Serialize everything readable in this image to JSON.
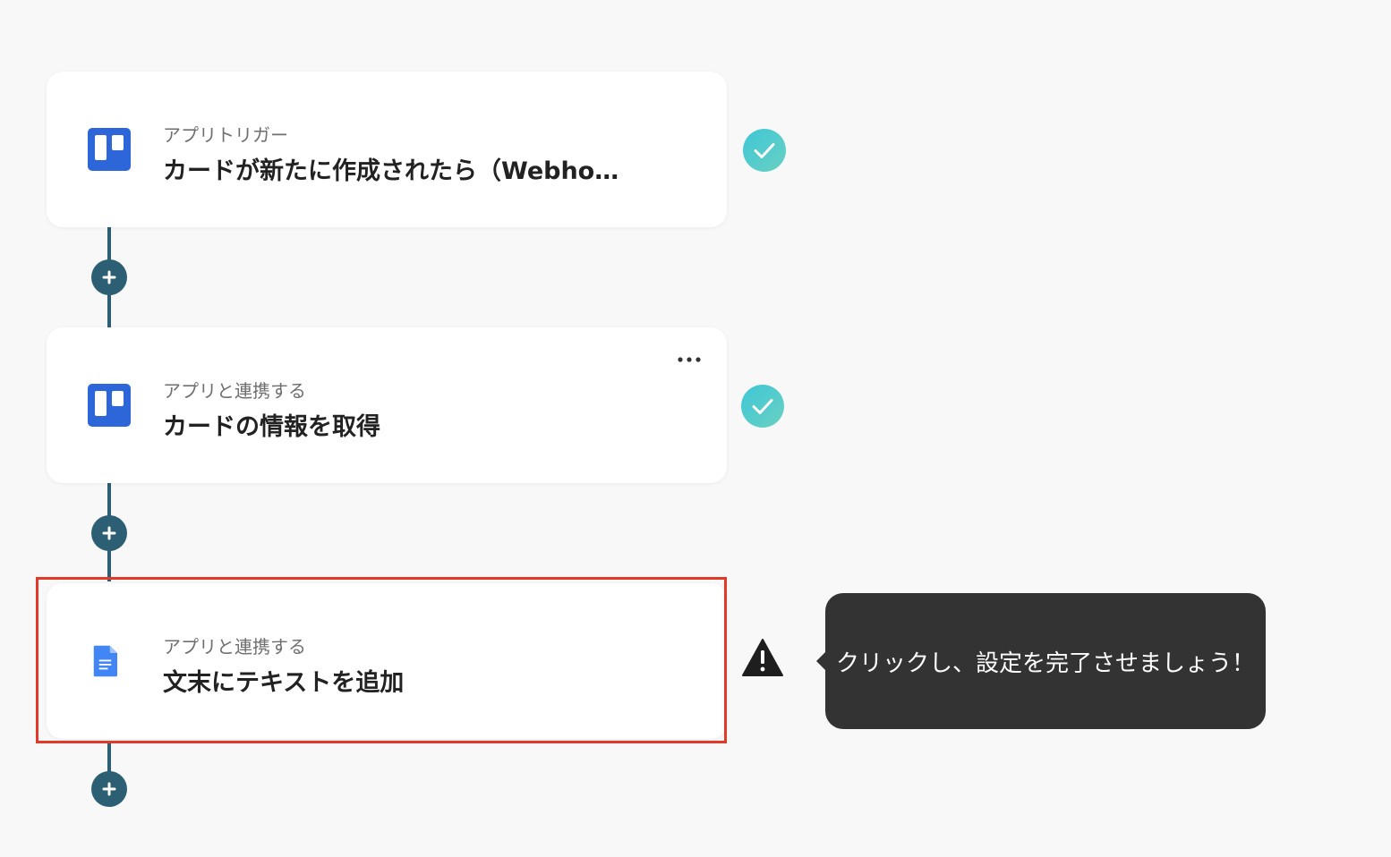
{
  "steps": [
    {
      "subtitle": "アプリトリガー",
      "title": "カードが新たに作成されたら（Webho…",
      "app_icon": "trello-icon",
      "status": "check-complete-icon"
    },
    {
      "subtitle": "アプリと連携する",
      "title": "カードの情報を取得",
      "app_icon": "trello-icon",
      "status": "check-complete-icon"
    },
    {
      "subtitle": "アプリと連携する",
      "title": "文末にテキストを追加",
      "app_icon": "google-docs-icon",
      "status": "warning-icon"
    }
  ],
  "tooltip": {
    "text": "クリックし、設定を完了させましょう！"
  },
  "colors": {
    "background": "#f8f8f9",
    "connector": "#2c5f73",
    "check_gradient_start": "#3ec7d6",
    "check_gradient_end": "#6ad0c2",
    "highlight": "#e23a28",
    "trello_blue": "#2c66d9",
    "docs_blue": "#4285f4",
    "tooltip_bg": "#333333"
  }
}
